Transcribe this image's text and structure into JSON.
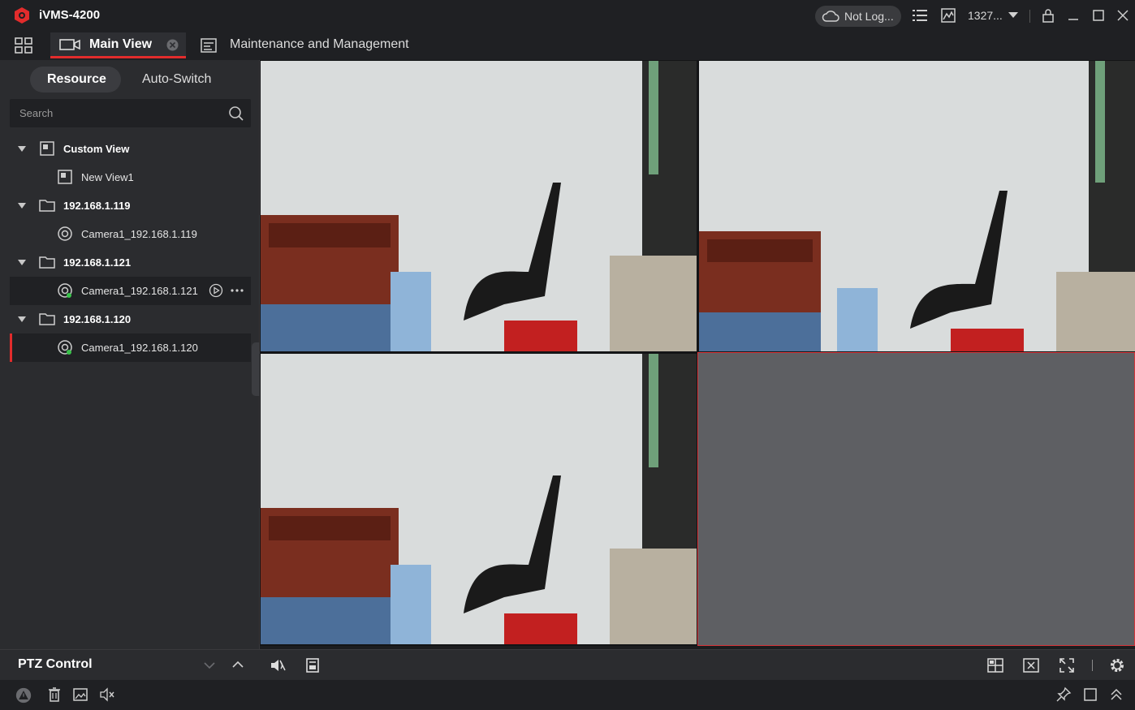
{
  "app": {
    "title": "iVMS-4200",
    "brand_color": "#e22c2c"
  },
  "titlebar": {
    "cloud_status": "Not Log...",
    "user": "1327...",
    "icons": [
      "task-list-icon",
      "alarm-image-icon",
      "lock-icon",
      "minimize-icon",
      "maximize-icon",
      "close-icon"
    ]
  },
  "tabs": {
    "main_view": "Main View",
    "maintenance": "Maintenance and Management"
  },
  "left_panel": {
    "segments": {
      "resource": "Resource",
      "auto_switch": "Auto-Switch"
    },
    "search_placeholder": "Search",
    "tree": [
      {
        "label": "Custom View",
        "type": "group"
      },
      {
        "label": "New View1",
        "type": "view"
      },
      {
        "label": "192.168.1.119",
        "type": "device"
      },
      {
        "label": "Camera1_192.168.1.119",
        "type": "camera"
      },
      {
        "label": "192.168.1.121",
        "type": "device"
      },
      {
        "label": "Camera1_192.168.1.121",
        "type": "camera"
      },
      {
        "label": "192.168.1.120",
        "type": "device"
      },
      {
        "label": "Camera1_192.168.1.120",
        "type": "camera"
      }
    ]
  },
  "ptz": {
    "label": "PTZ Control"
  },
  "video": {
    "layout": "2x2",
    "cells": [
      {
        "status": "live"
      },
      {
        "status": "live"
      },
      {
        "status": "live"
      },
      {
        "status": "empty"
      }
    ]
  }
}
